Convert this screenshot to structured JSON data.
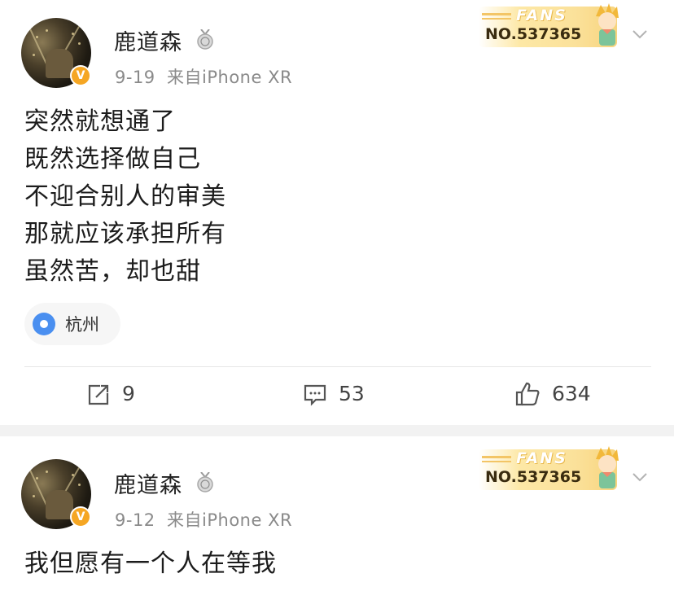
{
  "posts": [
    {
      "username": "鹿道森",
      "date": "9-19",
      "source": "来自iPhone XR",
      "fans_badge": {
        "word": "FANS",
        "number": "NO.537365"
      },
      "content_lines": [
        "突然就想通了",
        "既然选择做自己",
        "不迎合别人的审美",
        "那就应该承担所有",
        "虽然苦，却也甜"
      ],
      "location": "杭州",
      "actions": {
        "repost": "9",
        "comment": "53",
        "like": "634"
      }
    },
    {
      "username": "鹿道森",
      "date": "9-12",
      "source": "来自iPhone XR",
      "fans_badge": {
        "word": "FANS",
        "number": "NO.537365"
      },
      "content_lines": [
        "我但愿有一个人在等我"
      ]
    }
  ],
  "icons": {
    "verified": "verified-v-icon",
    "medal": "medal-icon",
    "chevron": "chevron-down-icon",
    "location": "location-pin-icon",
    "repost": "repost-icon",
    "comment": "comment-icon",
    "like": "thumbs-up-icon"
  },
  "colors": {
    "verified": "#f5a623",
    "location_pin": "#4a8ff0",
    "meta_text": "#8a8a8a",
    "separator": "#f2f2f2"
  }
}
